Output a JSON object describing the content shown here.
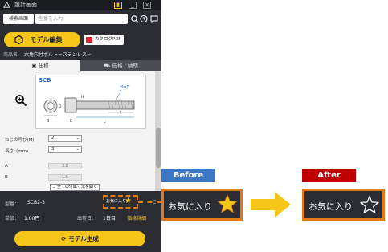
{
  "app": {
    "window_title": "設計画面",
    "search": {
      "type_label": "検索画面",
      "placeholder": "型番を入力"
    },
    "model_edit_label": "モデル編集",
    "catalog_pdf_label": "カタログPDF",
    "product_name_label": "商品名",
    "product_name": "六角穴付ボルト－ステンレス－",
    "tabs": [
      {
        "label": "仕様"
      },
      {
        "label": "価格 / 納期"
      }
    ],
    "drawing": {
      "series": "SCB",
      "labels": {
        "mxp": "M×P",
        "b": "B",
        "e": "E",
        "l": "L",
        "ell": "ℓ",
        "d": "D",
        "h": "H"
      }
    },
    "params": {
      "thread_pitch": {
        "label": "ねじの呼び(M)",
        "value": "2"
      },
      "length": {
        "label": "長さL(mm)",
        "value": "3"
      },
      "a": {
        "label": "A",
        "value": "3.8"
      },
      "b": {
        "label": "B",
        "value": "1.5"
      },
      "show_all_label": "全ての付属寸法を開く"
    },
    "type_row": {
      "label": "型番：",
      "value": "SCB2-3",
      "favorite_label": "お気に入り",
      "other": "C"
    },
    "price_row": {
      "unit_price_label": "単価：",
      "unit_price": "1.00円",
      "ship_label": "出荷日：",
      "ship_value": "1日目",
      "price_detail": "価格詳細"
    },
    "generate_label": "モデル生成"
  },
  "comparison": {
    "before_label": "Before",
    "after_label": "After",
    "favorite_label": "お気に入り",
    "before_star_color": "#f5c518",
    "after_star_color": "#ffffff",
    "accent": "#e07a10"
  }
}
